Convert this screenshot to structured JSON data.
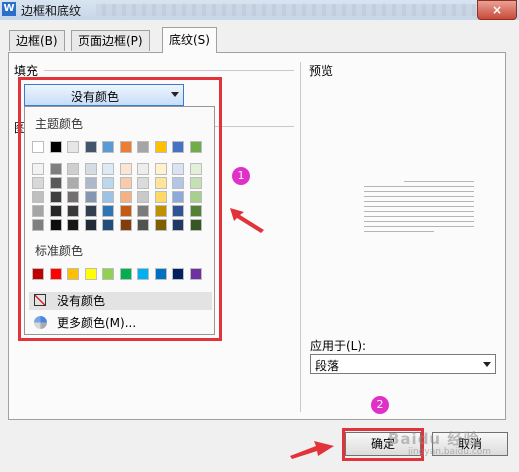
{
  "window": {
    "title": "边框和底纹",
    "close_icon": "×"
  },
  "tabs": [
    {
      "label": "边框(B)"
    },
    {
      "label": "页面边框(P)"
    },
    {
      "label": "底纹(S)"
    }
  ],
  "fill": {
    "group_label": "填充",
    "selected": "没有颜色",
    "partial_label": "图"
  },
  "palette": {
    "theme_label": "主题颜色",
    "standard_label": "标准颜色",
    "theme_top": [
      "#ffffff",
      "#000000",
      "#e7e6e6",
      "#44546a",
      "#5b9bd5",
      "#ed7d31",
      "#a5a5a5",
      "#ffc000",
      "#4472c4",
      "#70ad47"
    ],
    "theme_shades": [
      [
        "#f2f2f2",
        "#7f7f7f",
        "#d0cece",
        "#d6dce4",
        "#deebf6",
        "#fbe5d5",
        "#ededed",
        "#fff2cc",
        "#dae3f3",
        "#e2efd9"
      ],
      [
        "#d8d8d8",
        "#595959",
        "#aeabab",
        "#adb9ca",
        "#bdd7ee",
        "#f7cbac",
        "#dbdbdb",
        "#fee599",
        "#b4c6e7",
        "#c5e0b3"
      ],
      [
        "#bfbfbf",
        "#3f3f3f",
        "#757070",
        "#8496b0",
        "#9cc3e5",
        "#f4b183",
        "#c9c9c9",
        "#ffd965",
        "#8eaadb",
        "#a8d08d"
      ],
      [
        "#a5a5a5",
        "#262626",
        "#3a3838",
        "#323f4f",
        "#2e75b5",
        "#c55a11",
        "#7b7b7b",
        "#bf9000",
        "#2f5496",
        "#538135"
      ],
      [
        "#7f7f7f",
        "#0c0c0c",
        "#171616",
        "#222a35",
        "#1e4e79",
        "#833c0b",
        "#525252",
        "#7f6000",
        "#1f3864",
        "#375623"
      ]
    ],
    "standard": [
      "#c00000",
      "#ff0000",
      "#ffc000",
      "#ffff00",
      "#92d050",
      "#00b050",
      "#00b0f0",
      "#0070c0",
      "#002060",
      "#7030a0"
    ],
    "no_color": "没有颜色",
    "more_colors": "更多颜色(M)..."
  },
  "preview": {
    "label": "预览"
  },
  "apply": {
    "label": "应用于(L):",
    "value": "段落"
  },
  "buttons": {
    "ok": "确定",
    "cancel": "取消"
  },
  "annotations": {
    "step1": "1",
    "step2": "2",
    "accent": "#e2323a",
    "badge_color": "#e030c8"
  },
  "watermark": {
    "text": "Baidu 经验",
    "sub": "jingyan.baidu.com"
  }
}
